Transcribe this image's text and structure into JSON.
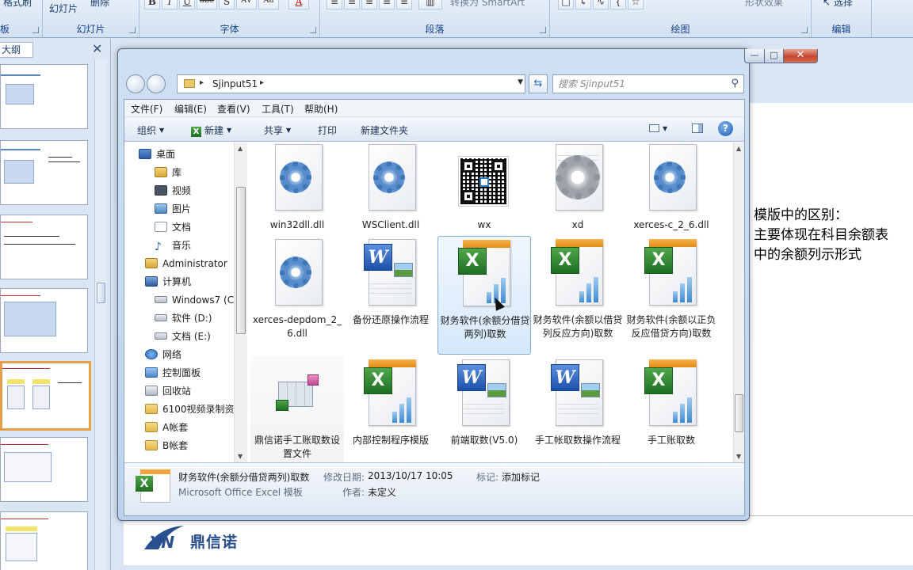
{
  "ribbon": {
    "groups": [
      {
        "title": "板",
        "buttons": [
          "格式刷"
        ]
      },
      {
        "title": "幻灯片",
        "buttons": [
          "幻灯片",
          "删除"
        ]
      },
      {
        "title": "字体",
        "buttons": [
          "B",
          "I",
          "U",
          "abe",
          "S",
          "AV",
          "Aa",
          "A"
        ]
      },
      {
        "title": "段落",
        "buttons": [
          "转换为 SmartArt"
        ]
      },
      {
        "title": "绘图",
        "buttons": [
          "形状效果"
        ]
      },
      {
        "title": "编辑",
        "buttons": [
          "选择"
        ]
      }
    ]
  },
  "outline_pane": {
    "tab_label": "大纲",
    "close_symbol": "✕"
  },
  "explorer": {
    "window_buttons": {
      "minimize": "—",
      "maximize": "□",
      "close": "✕"
    },
    "address": {
      "crumb": "Sjinput51",
      "separator": "▸"
    },
    "search": {
      "placeholder": "搜索 Sjinput51"
    },
    "menus": [
      "文件(F)",
      "编辑(E)",
      "查看(V)",
      "工具(T)",
      "帮助(H)"
    ],
    "commands": {
      "organize": "组织",
      "new": "新建",
      "share": "共享",
      "print": "打印",
      "new_folder": "新建文件夹"
    },
    "nav_items": [
      {
        "label": "桌面",
        "icon": "desktop-icon"
      },
      {
        "label": "库",
        "icon": "library-icon"
      },
      {
        "label": "视频",
        "icon": "video-icon"
      },
      {
        "label": "图片",
        "icon": "picture-icon"
      },
      {
        "label": "文档",
        "icon": "document-icon"
      },
      {
        "label": "音乐",
        "icon": "music-icon"
      },
      {
        "label": "Administrator",
        "icon": "user-folder-icon"
      },
      {
        "label": "计算机",
        "icon": "computer-icon"
      },
      {
        "label": "Windows7 (C:",
        "icon": "windows-drive-icon"
      },
      {
        "label": "软件 (D:)",
        "icon": "drive-icon"
      },
      {
        "label": "文档 (E:)",
        "icon": "drive-icon"
      },
      {
        "label": "网络",
        "icon": "network-icon"
      },
      {
        "label": "控制面板",
        "icon": "control-panel-icon"
      },
      {
        "label": "回收站",
        "icon": "recycle-bin-icon"
      },
      {
        "label": "6100视频录制资",
        "icon": "folder-icon"
      },
      {
        "label": "A帐套",
        "icon": "folder-icon"
      },
      {
        "label": "B帐套",
        "icon": "folder-icon"
      }
    ],
    "files": [
      {
        "name": "win32dll.dll",
        "type": "dll"
      },
      {
        "name": "WSClient.dll",
        "type": "dll"
      },
      {
        "name": "wx",
        "type": "qr"
      },
      {
        "name": "xd",
        "type": "gear"
      },
      {
        "name": "xerces-c_2_6.dll",
        "type": "dll"
      },
      {
        "name": "xerces-depdom_2_6.dll",
        "type": "dll"
      },
      {
        "name": "备份还原操作流程",
        "type": "word"
      },
      {
        "name": "财务软件(余额分借贷两列)取数",
        "type": "excel",
        "selected": true
      },
      {
        "name": "财务软件(余额以借贷列反应方向)取数",
        "type": "excel"
      },
      {
        "name": "财务软件(余额以正负反应借贷方向)取数",
        "type": "excel"
      },
      {
        "name": "鼎信诺手工账取数设置文件",
        "type": "cube"
      },
      {
        "name": "内部控制程序模版",
        "type": "excel"
      },
      {
        "name": "前端取数(V5.0)",
        "type": "word"
      },
      {
        "name": "手工帐取数操作流程",
        "type": "word"
      },
      {
        "name": "手工账取数",
        "type": "excel"
      }
    ],
    "details": {
      "filename": "财务软件(余额分借贷两列)取数",
      "type": "Microsoft Office Excel 模板",
      "modified_label": "修改日期:",
      "modified_value": "2013/10/17 10:05",
      "tags_label": "标记:",
      "tags_value": "添加标记",
      "author_label": "作者:",
      "author_value": "未定义"
    }
  },
  "slide": {
    "lines": [
      "模版中的区别：",
      "主要体现在科目余额表",
      "中的余额列示形式"
    ],
    "logo_text": "鼎信诺",
    "logo_mark": "XN"
  }
}
